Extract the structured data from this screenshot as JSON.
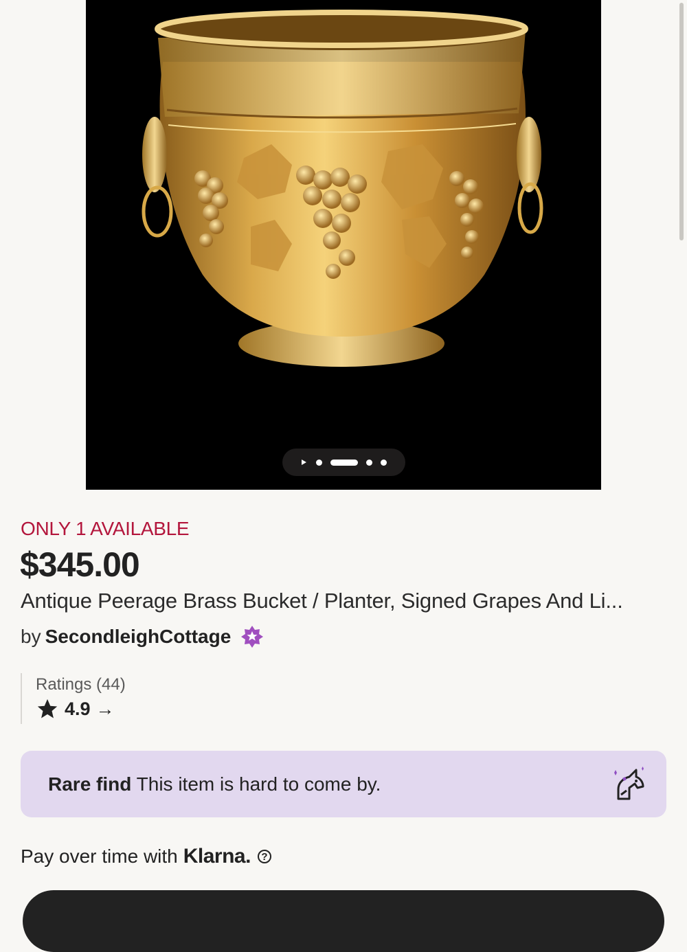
{
  "gallery": {
    "image_alt": "Antique brass bucket planter with embossed grapes and lion head ring handles",
    "slide_count": 4,
    "active_slide": 2
  },
  "listing": {
    "availability": "ONLY 1 AVAILABLE",
    "price": "$345.00",
    "title": "Antique Peerage Brass Bucket / Planter, Signed Grapes And Li...",
    "by_prefix": "by",
    "shop_name": "SecondleighCottage"
  },
  "ratings": {
    "label": "Ratings (44)",
    "score": "4.9",
    "arrow": "→"
  },
  "rare_find": {
    "bold": "Rare find",
    "text": "This item is hard to come by."
  },
  "payment": {
    "text": "Pay over time with",
    "brand": "Klarna.",
    "help": "?"
  },
  "colors": {
    "availability": "#b3163c",
    "rare_bg": "#e2d8ef",
    "badge": "#a04fbf",
    "dark": "#222222"
  }
}
